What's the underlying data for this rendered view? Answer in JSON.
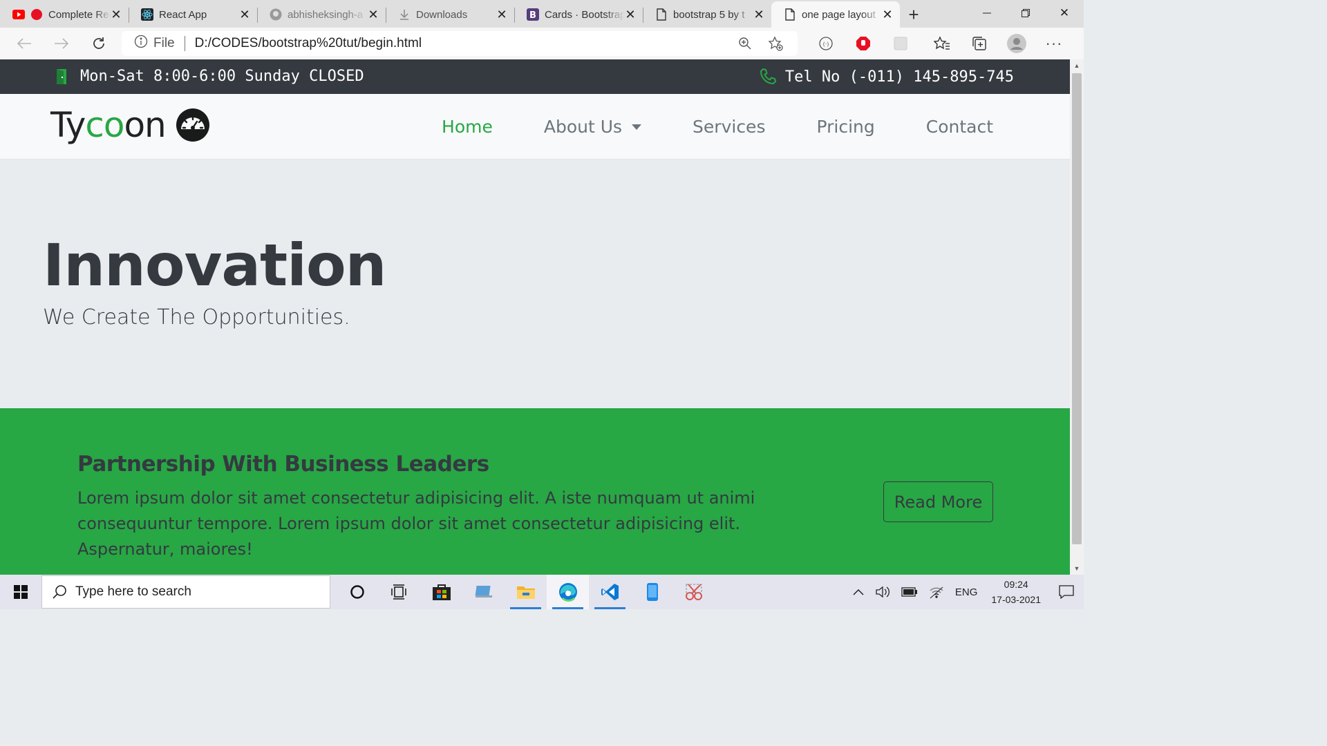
{
  "browser": {
    "tabs": [
      {
        "title": "Complete React",
        "icon": "youtube-icon",
        "active": false
      },
      {
        "title": "React App",
        "icon": "react-icon",
        "active": false
      },
      {
        "title": "abhisheksingh-a",
        "icon": "github-icon",
        "active": false
      },
      {
        "title": "Downloads",
        "icon": "download-icon",
        "active": false
      },
      {
        "title": "Cards · Bootstrap",
        "icon": "bootstrap-icon",
        "active": false
      },
      {
        "title": "bootstrap 5 by t",
        "icon": "file-icon",
        "active": false
      },
      {
        "title": "one page layout",
        "icon": "file-icon",
        "active": true
      }
    ],
    "address": {
      "file_label": "File",
      "url": "D:/CODES/bootstrap%20tut/begin.html"
    }
  },
  "page": {
    "topbar": {
      "hours": "Mon-Sat 8:00-6:00 Sunday CLOSED",
      "phone": "Tel No (-011) 145-895-745"
    },
    "brand": {
      "part1": "Ty",
      "part2": "co",
      "part3": "on"
    },
    "nav": {
      "home": "Home",
      "about": "About Us",
      "services": "Services",
      "pricing": "Pricing",
      "contact": "Contact"
    },
    "hero": {
      "title": "Innovation",
      "subtitle": "We Create The Opportunities."
    },
    "partner": {
      "heading": "Partnership With Business Leaders",
      "text": "Lorem ipsum dolor sit amet consectetur adipisicing elit. A iste numquam ut animi consequuntur tempore. Lorem ipsum dolor sit amet consectetur adipisicing elit. Aspernatur, maiores!",
      "button": "Read More"
    }
  },
  "taskbar": {
    "search_placeholder": "Type here to search",
    "language": "ENG",
    "time": "09:24",
    "date": "17-03-2021"
  },
  "colors": {
    "accent_green": "#28a745",
    "dark": "#343a40",
    "light": "#f8f9fa",
    "hero_bg": "#e9ecef"
  }
}
